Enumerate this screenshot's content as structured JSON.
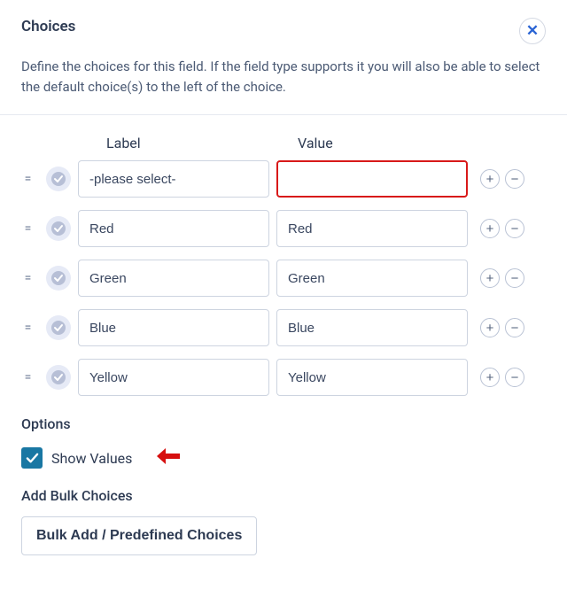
{
  "header": {
    "title": "Choices",
    "close_symbol": "✕"
  },
  "description": "Define the choices for this field. If the field type supports it you will also be able to select the default choice(s) to the left of the choice.",
  "columns": {
    "label": "Label",
    "value": "Value"
  },
  "rows": [
    {
      "label": "-please select-",
      "value": "",
      "highlight_value": true
    },
    {
      "label": "Red",
      "value": "Red",
      "highlight_value": false
    },
    {
      "label": "Green",
      "value": "Green",
      "highlight_value": false
    },
    {
      "label": "Blue",
      "value": "Blue",
      "highlight_value": false
    },
    {
      "label": "Yellow",
      "value": "Yellow",
      "highlight_value": false
    }
  ],
  "options": {
    "heading": "Options",
    "show_values_label": "Show Values",
    "show_values_checked": true
  },
  "bulk": {
    "heading": "Add Bulk Choices",
    "button_label": "Bulk Add / Predefined Choices"
  },
  "glyphs": {
    "drag": "=",
    "plus": "+",
    "minus": "−"
  }
}
